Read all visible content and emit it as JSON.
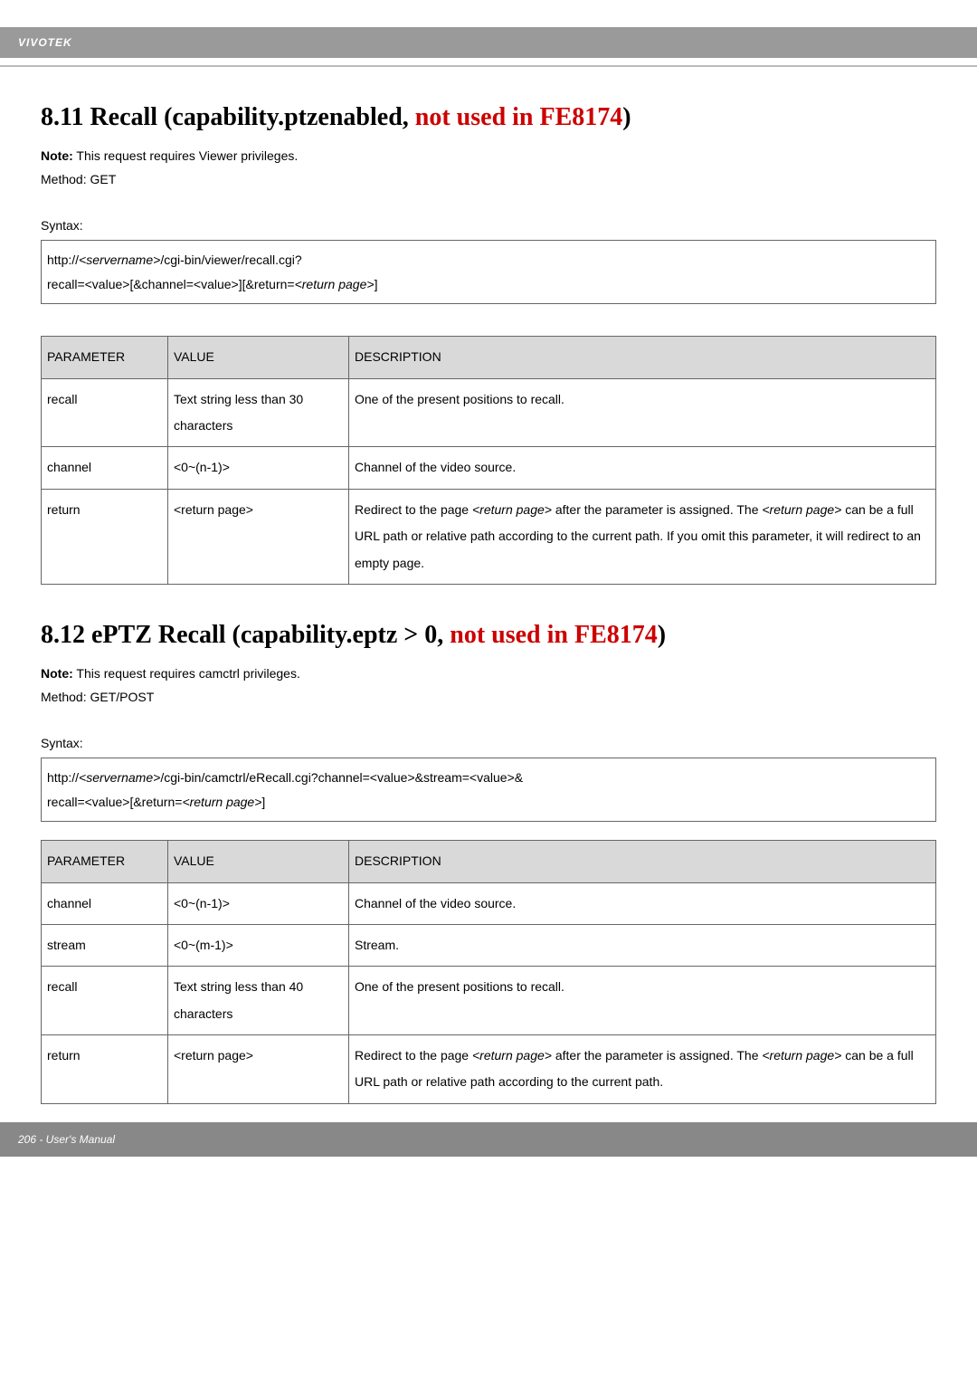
{
  "header": {
    "brand": "VIVOTEK"
  },
  "section1": {
    "heading_prefix": "8.11 Recall (capability.ptzenabled, ",
    "heading_red": "not used in FE8174",
    "heading_suffix": ")",
    "note_label": "Note:",
    "note_text": " This request requires Viewer privileges.",
    "method": "Method: GET",
    "syntax_label": "Syntax:",
    "syntax_line1_a": "http://",
    "syntax_line1_b": "<servername>",
    "syntax_line1_c": "/cgi-bin/viewer/recall.cgi?",
    "syntax_line2_a": "recall=<value>[&channel=<value>][&return=",
    "syntax_line2_b": "<return page>",
    "syntax_line2_c": "]",
    "table": {
      "headers": {
        "param": "PARAMETER",
        "value": "VALUE",
        "desc": "DESCRIPTION"
      },
      "rows": [
        {
          "param": "recall",
          "value": "Text string less than 30 characters",
          "desc": "One of the present positions to recall."
        },
        {
          "param": "channel",
          "value": "<0~(n-1)>",
          "desc": "Channel of the video source."
        },
        {
          "param": "return",
          "value": "<return page>",
          "desc_a": "Redirect to the page ",
          "desc_b": "<return page>",
          "desc_c": " after the parameter is assigned. The ",
          "desc_d": "<return page>",
          "desc_e": " can be a full URL path or relative path according to the current path. If you omit this parameter, it will redirect to an empty page."
        }
      ]
    }
  },
  "section2": {
    "heading_prefix": "8.12 ePTZ Recall (capability.eptz > 0, ",
    "heading_red": "not used in FE8174",
    "heading_suffix": ")",
    "note_label": "Note:",
    "note_text": " This request requires camctrl privileges.",
    "method": "Method: GET/POST",
    "syntax_label": "Syntax:",
    "syntax_line1_a": "http://",
    "syntax_line1_b": "<servername>",
    "syntax_line1_c": "/cgi-bin/camctrl/eRecall.cgi?channel=<value>&stream=<value>&",
    "syntax_line2_a": "recall=<value>[&return=",
    "syntax_line2_b": "<return page>",
    "syntax_line2_c": "]",
    "table": {
      "headers": {
        "param": "PARAMETER",
        "value": "VALUE",
        "desc": "DESCRIPTION"
      },
      "rows": [
        {
          "param": "channel",
          "value": "<0~(n-1)>",
          "desc": "Channel of the video source."
        },
        {
          "param": "stream",
          "value": "<0~(m-1)>",
          "desc": "Stream."
        },
        {
          "param": "recall",
          "value": "Text string less than 40 characters",
          "desc": "One of the present positions to recall."
        },
        {
          "param": "return",
          "value": "<return page>",
          "desc_a": "Redirect to the page ",
          "desc_b": "<return page>",
          "desc_c": " after the parameter is assigned. The ",
          "desc_d": "<return page>",
          "desc_e": " can be a full URL path or relative path according to the current path."
        }
      ]
    }
  },
  "footer": {
    "text": "206 - User's Manual"
  }
}
